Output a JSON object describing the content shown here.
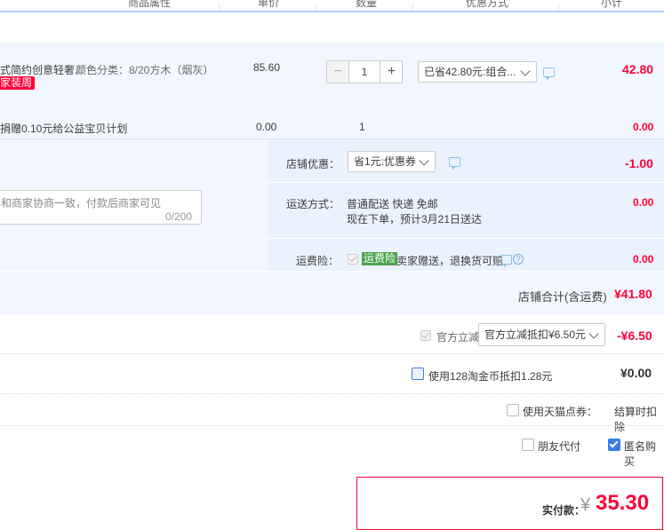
{
  "header": {
    "col_attr": "商品属性",
    "col_price": "单价",
    "col_qty": "数量",
    "col_discount": "优惠方式",
    "col_subtotal": "小计"
  },
  "item": {
    "name": "式简约创意轻奢...",
    "attr": "颜色分类：8/20方木（烟灰）",
    "tag": "家装周",
    "price": "85.60",
    "qty": "1",
    "qty_minus": "−",
    "qty_plus": "+",
    "discount_select": "已省42.80元:组合...",
    "subtotal": "42.80"
  },
  "charity": {
    "text": "捐赠0.10元给公益宝贝计划",
    "price": "0.00",
    "qty": "1",
    "subtotal": "0.00"
  },
  "shop": {
    "coupon_label": "店铺优惠：",
    "coupon_select": "省1元:优惠券",
    "coupon_value": "-1.00",
    "message_text": "和商家协商一致，付款后商家可见",
    "message_count": "0/200",
    "shipping_label": "运送方式：",
    "shipping_method": "普通配送 快递 免邮",
    "shipping_eta": "现在下单，预计3月21日送达",
    "shipping_value": "0.00",
    "insurance_label": "运费险：",
    "insurance_badge": "运费险",
    "insurance_text": "卖家赠送，退换货可赔",
    "insurance_value": "0.00",
    "total_label": "店铺合计(含运费)",
    "total_value": "¥41.80"
  },
  "order": {
    "official_label": "官方立减",
    "official_select": "官方立减抵扣¥6.50元",
    "official_value": "-¥6.50",
    "coins_label": "使用128淘金币抵扣1.28元",
    "coins_value": "¥0.00",
    "tmall_label": "使用天猫点券：",
    "tmall_value": "结算时扣除",
    "friend_pay_label": "朋友代付",
    "anonymous_label": "匿名购买",
    "pay_label": "实付款：",
    "pay_currency": "¥",
    "pay_value": "35.30"
  },
  "colors": {
    "accent_red": "#ff0036",
    "light_blue": "#f2f7ff",
    "header_line": "#b2d1ff",
    "checkbox_blue": "#3b7be8",
    "badge_green": "#4da24d"
  }
}
